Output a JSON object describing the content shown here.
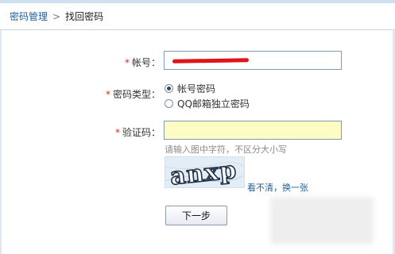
{
  "breadcrumb": {
    "parent": "密码管理",
    "separator": ">",
    "current": "找回密码"
  },
  "form": {
    "account": {
      "required_mark": "*",
      "label": "帐号：",
      "value_redacted": true
    },
    "password_type": {
      "required_mark": "*",
      "label": "密码类型：",
      "options": [
        {
          "label": "帐号密码",
          "checked": true
        },
        {
          "label": "QQ邮箱独立密码",
          "checked": false
        }
      ]
    },
    "captcha": {
      "required_mark": "*",
      "label": "验证码：",
      "value": "",
      "hint": "请输入图中字符，不区分大小写",
      "image_text": "anxp",
      "refresh_link": "看不清，换一张"
    },
    "submit_label": "下一步"
  },
  "colors": {
    "link": "#1f5f9d",
    "required": "#d62b2b",
    "captcha_input_bg": "#fffcc4",
    "redaction": "#e0141b"
  }
}
